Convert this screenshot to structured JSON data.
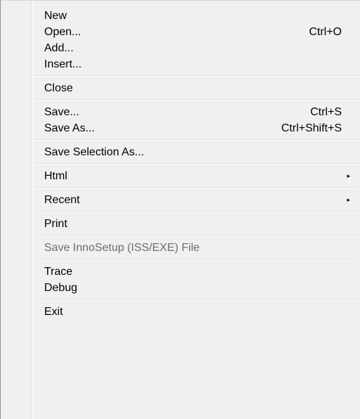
{
  "menu": {
    "groups": [
      [
        {
          "label": "New",
          "shortcut": ""
        },
        {
          "label": "Open...",
          "shortcut": "Ctrl+O"
        },
        {
          "label": "Add...",
          "shortcut": ""
        },
        {
          "label": "Insert...",
          "shortcut": ""
        }
      ],
      [
        {
          "label": "Close",
          "shortcut": ""
        }
      ],
      [
        {
          "label": "Save...",
          "shortcut": "Ctrl+S"
        },
        {
          "label": "Save As...",
          "shortcut": "Ctrl+Shift+S"
        }
      ],
      [
        {
          "label": "Save Selection As...",
          "shortcut": ""
        }
      ],
      [
        {
          "label": "Html",
          "submenu": true
        }
      ],
      [
        {
          "label": "Recent",
          "submenu": true
        }
      ],
      [
        {
          "label": "Print",
          "shortcut": ""
        }
      ],
      [
        {
          "label": "Save InnoSetup (ISS/EXE) File",
          "disabled": true
        }
      ],
      [
        {
          "label": "Trace",
          "shortcut": ""
        },
        {
          "label": "Debug",
          "shortcut": ""
        }
      ],
      [
        {
          "label": "Exit",
          "shortcut": ""
        }
      ]
    ],
    "submenu_arrow": "▸",
    "colors": {
      "background": "#f0f0f0",
      "text": "#000000",
      "disabled_text": "#6d6d6d",
      "separator": "#e0e0e0"
    }
  }
}
